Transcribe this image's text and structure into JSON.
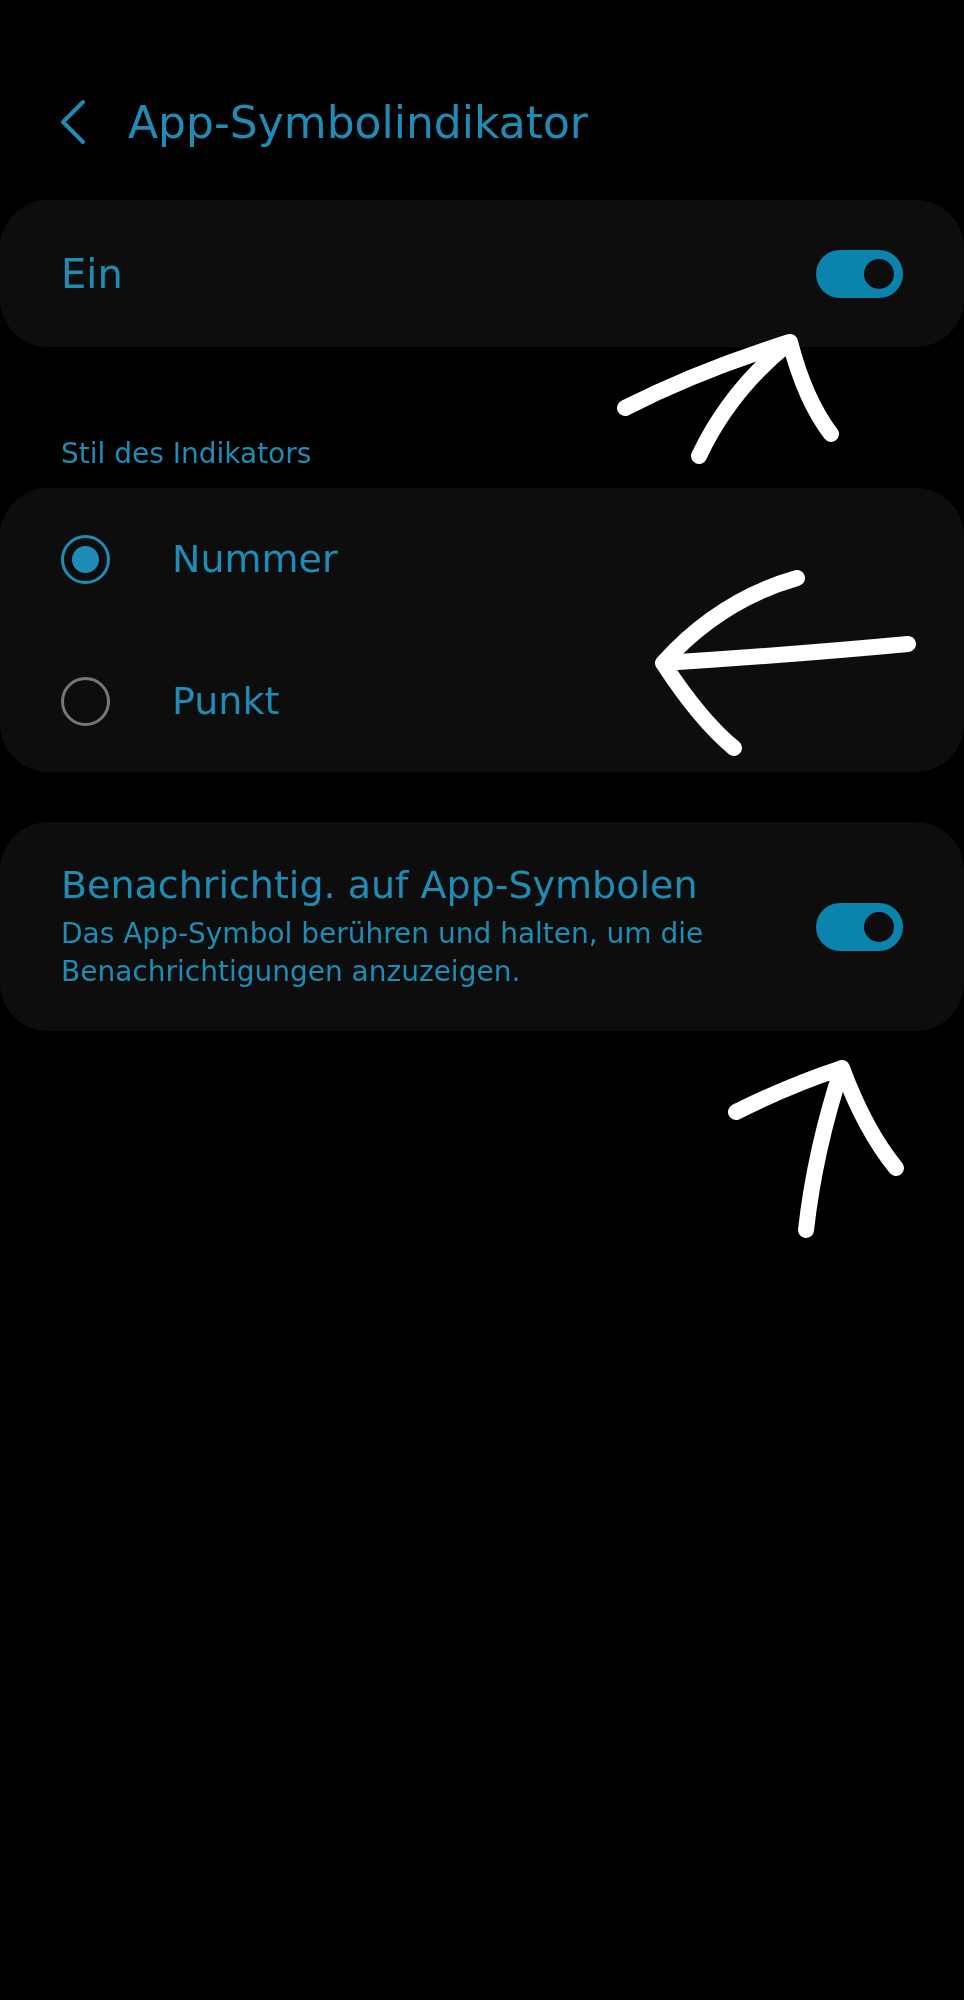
{
  "header": {
    "title": "App-Symbolindikator"
  },
  "master_switch": {
    "label": "Ein",
    "on": true
  },
  "style_section": {
    "title": "Stil des Indikators",
    "options": [
      {
        "label": "Nummer",
        "selected": true
      },
      {
        "label": "Punkt",
        "selected": false
      }
    ]
  },
  "notification_setting": {
    "title": "Benachrichtig. auf App-Symbolen",
    "description": "Das App-Symbol berühren und halten, um die Benachrichtigungen anzuzeigen.",
    "on": true
  }
}
